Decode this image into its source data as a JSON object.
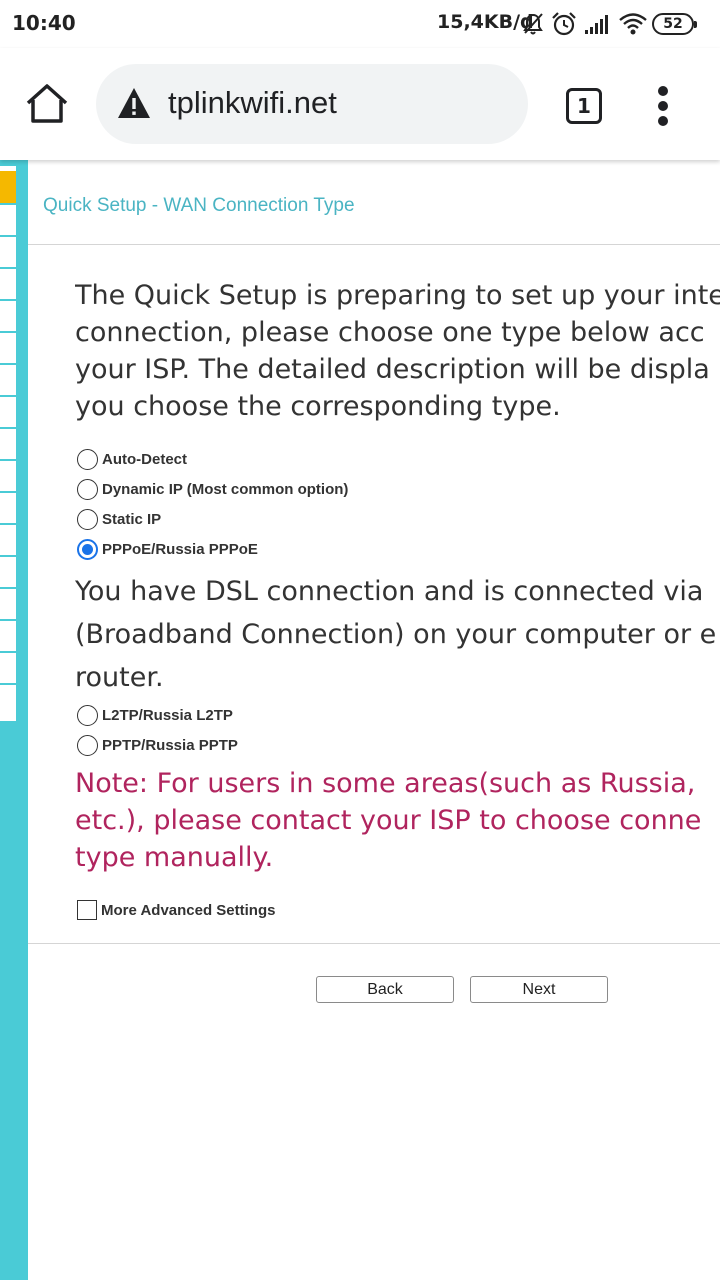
{
  "status_bar": {
    "time": "10:40",
    "network_speed": "15,4KB/d",
    "battery": "52",
    "icons": [
      "mute-icon",
      "alarm-icon",
      "signal-icon",
      "wifi-icon",
      "battery-icon"
    ]
  },
  "browser": {
    "url": "tplinkwifi.net",
    "tab_count": "1",
    "security_icon": "warning-icon",
    "home_icon": "home-icon",
    "menu_icon": "more-vert-icon"
  },
  "page": {
    "title": "Quick Setup - WAN Connection Type",
    "intro_lines": [
      "The Quick Setup is preparing to set up your inte",
      "connection, please choose one type below acc",
      "your ISP. The detailed description will be displa",
      "you choose the corresponding type."
    ],
    "options": [
      {
        "label": "Auto-Detect",
        "checked": false
      },
      {
        "label": "Dynamic IP (Most common option)",
        "checked": false
      },
      {
        "label": "Static IP",
        "checked": false
      },
      {
        "label": "PPPoE/Russia PPPoE",
        "checked": true
      },
      {
        "label": "L2TP/Russia L2TP",
        "checked": false
      },
      {
        "label": "PPTP/Russia PPTP",
        "checked": false
      }
    ],
    "description_lines": [
      "You have DSL connection and is connected via",
      "(Broadband Connection) on your computer or e",
      "router."
    ],
    "note_lines": [
      "Note: For users in some areas(such as Russia,",
      "etc.), please contact your ISP to choose conne",
      "type manually."
    ],
    "advanced_label": "More Advanced Settings",
    "advanced_checked": false,
    "back_label": "Back",
    "next_label": "Next"
  },
  "colors": {
    "accent": "#4acbd6",
    "title": "#4ab4c3",
    "note": "#b0245e",
    "active_nav": "#f5b800",
    "radio_checked": "#1a73e8"
  }
}
